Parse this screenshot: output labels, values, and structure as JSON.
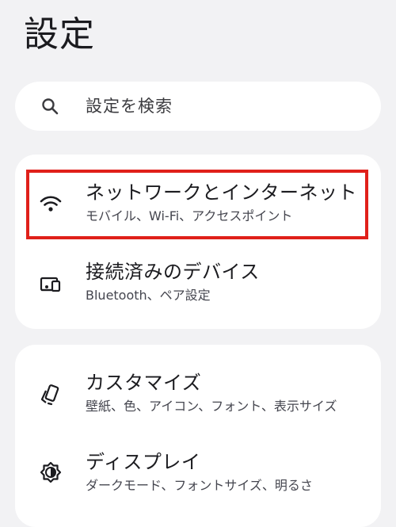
{
  "header": {
    "title": "設定"
  },
  "search": {
    "placeholder": "設定を検索",
    "icon": "search-icon"
  },
  "sections": [
    {
      "items": [
        {
          "icon": "wifi-icon",
          "title": "ネットワークとインターネット",
          "subtitle": "モバイル、Wi-Fi、アクセスポイント"
        },
        {
          "icon": "connected-devices-icon",
          "title": "接続済みのデバイス",
          "subtitle": "Bluetooth、ペア設定"
        }
      ]
    },
    {
      "items": [
        {
          "icon": "customize-icon",
          "title": "カスタマイズ",
          "subtitle": "壁紙、色、アイコン、フォント、表示サイズ"
        },
        {
          "icon": "display-icon",
          "title": "ディスプレイ",
          "subtitle": "ダークモード、フォントサイズ、明るさ"
        }
      ]
    }
  ],
  "colors": {
    "background": "#f2f2f4",
    "card": "#ffffff",
    "highlight": "#e0201a",
    "text_primary": "#1b1b1f",
    "text_secondary": "#45464f"
  }
}
